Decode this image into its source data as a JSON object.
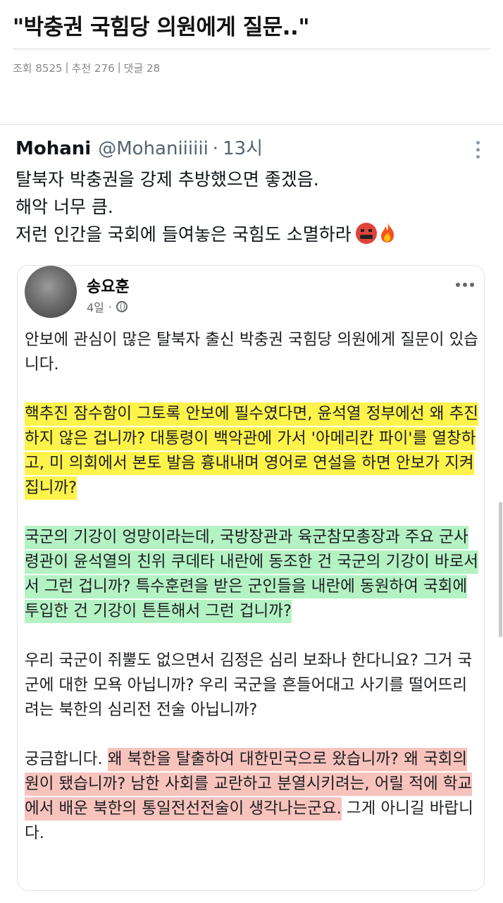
{
  "post": {
    "title": "\"박충권 국힘당 의원에게 질문..\"",
    "meta": {
      "views": "조회 8525",
      "sep1": "|",
      "likes": "추천 276",
      "sep2": "|",
      "comments": "댓글 28"
    }
  },
  "tweet": {
    "name": "Mohani",
    "handle": "@Mohaniiiiii",
    "dot": "·",
    "time": "13시",
    "lines": [
      "탈북자 박충권을 강제 추방했으면 좋겠음.",
      "해악 너무 큼.",
      "저런 인간을 국회에 들여놓은 국힘도 소멸하라"
    ],
    "emojis": [
      "angry-cursing-face-icon",
      "fire-icon"
    ]
  },
  "fb": {
    "author": "송요훈",
    "time": "4일",
    "dot": "·",
    "p1": "안보에 관심이  많은 탈북자 출신 박충권 국힘당 의원에게 질문이 있습니다.",
    "p2": "핵추진 잠수함이 그토록 안보에 필수였다면, 윤석열 정부에선 왜 추진하지 않은 겁니까? 대통령이 백악관에 가서 '아메리칸 파이'를 열창하고, 미 의회에서 본토 발음 흉내내며 영어로 연설을 하면 안보가 지켜집니까?",
    "p3": "국군의 기강이 엉망이라는데, 국방장관과 육군참모총장과 주요 군사령관이 윤석열의 친위 쿠데타 내란에 동조한 건 국군의 기강이 바로서서 그런 겁니까? 특수훈련을 받은 군인들을 내란에 동원하여 국회에 투입한 건 기강이 튼튼해서 그런 겁니까?",
    "p4": "우리 국군이 쥐뿔도 없으면서 김정은 심리 보좌나 한다니요? 그거 국군에 대한 모욕 아닙니까? 우리 국군을 흔들어대고 사기를 떨어뜨리려는 북한의 심리전 전술 아닙니까?",
    "p5_plain": "궁금합니다. ",
    "p5_highlight": "왜 북한을 탈출하여 대한민국으로 왔습니까? 왜 국회의원이 됐습니까? 남한 사회를 교란하고 분열시키려는, 어릴 적에 학교에서 배운 북한의 통일전선전술이 생각나는군요.",
    "p5_tail": " 그게 아니길 바랍니다.",
    "highlight_colors": {
      "yellow": "#fdf34a",
      "green": "#b4f2c4",
      "red": "#f8c3bd"
    }
  }
}
